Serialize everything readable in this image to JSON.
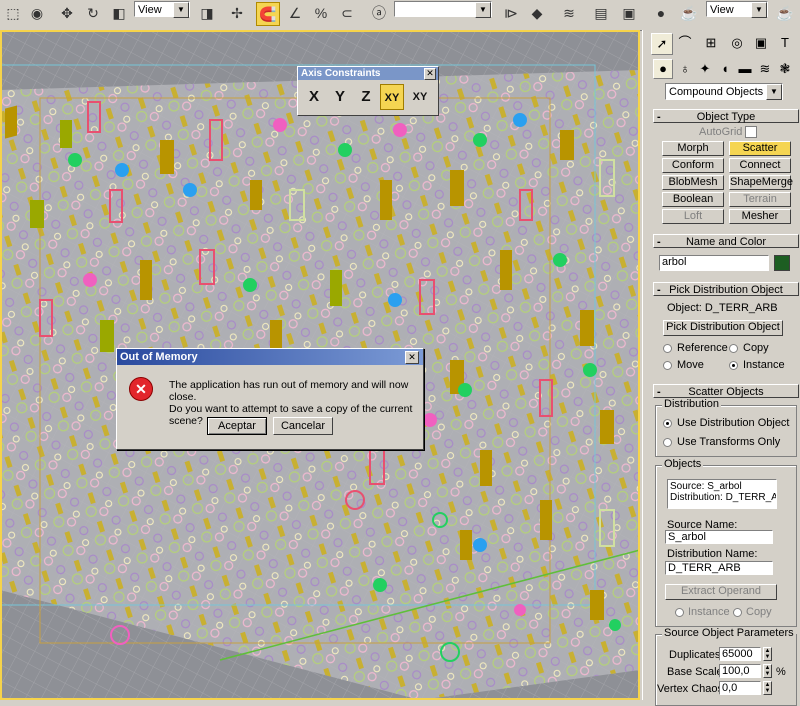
{
  "toolbar": {
    "view_left": "View",
    "view_right": "View"
  },
  "axis_constraints": {
    "title": "Axis Constraints",
    "buttons": [
      "X",
      "Y",
      "Z",
      "XY",
      "XY"
    ]
  },
  "dialog": {
    "title": "Out of Memory",
    "line1": "The application has run out of memory and will now close.",
    "line2": "Do you want to attempt to save a copy of the current scene?",
    "ok_label": "Aceptar",
    "cancel_label": "Cancelar"
  },
  "panel": {
    "category": "Compound Objects",
    "object_type": {
      "header": "Object Type",
      "autogrid": "AutoGrid",
      "buttons": [
        "Morph",
        "Scatter",
        "Conform",
        "Connect",
        "BlobMesh",
        "ShapeMerge",
        "Boolean",
        "Terrain",
        "Loft",
        "Mesher"
      ]
    },
    "name_color": {
      "header": "Name and Color",
      "name": "arbol",
      "color": "#1d5e22"
    },
    "pick": {
      "header": "Pick Distribution Object",
      "object_label": "Object: D_TERR_ARB",
      "button": "Pick Distribution Object",
      "reference": "Reference",
      "copy": "Copy",
      "move": "Move",
      "instance": "Instance"
    },
    "scatter": {
      "header": "Scatter Objects",
      "distribution_label": "Distribution",
      "use_dist": "Use Distribution Object",
      "use_trans": "Use Transforms Only",
      "objects_label": "Objects",
      "list": [
        "Source: S_arbol",
        "Distribution: D_TERR_ARI"
      ],
      "source_name_label": "Source Name:",
      "source_name": "S_arbol",
      "dist_name_label": "Distribution Name:",
      "dist_name": "D_TERR_ARB",
      "extract": "Extract Operand",
      "instance": "Instance",
      "copy": "Copy"
    },
    "source_params": {
      "header": "Source Object Parameters",
      "duplicates_label": "Duplicates:",
      "duplicates": "65000",
      "base_scale_label": "Base Scale:",
      "base_scale": "100,0",
      "percent": "%",
      "vertex_chaos_label": "Vertex Chaos:",
      "vertex_chaos": "0,0"
    }
  }
}
